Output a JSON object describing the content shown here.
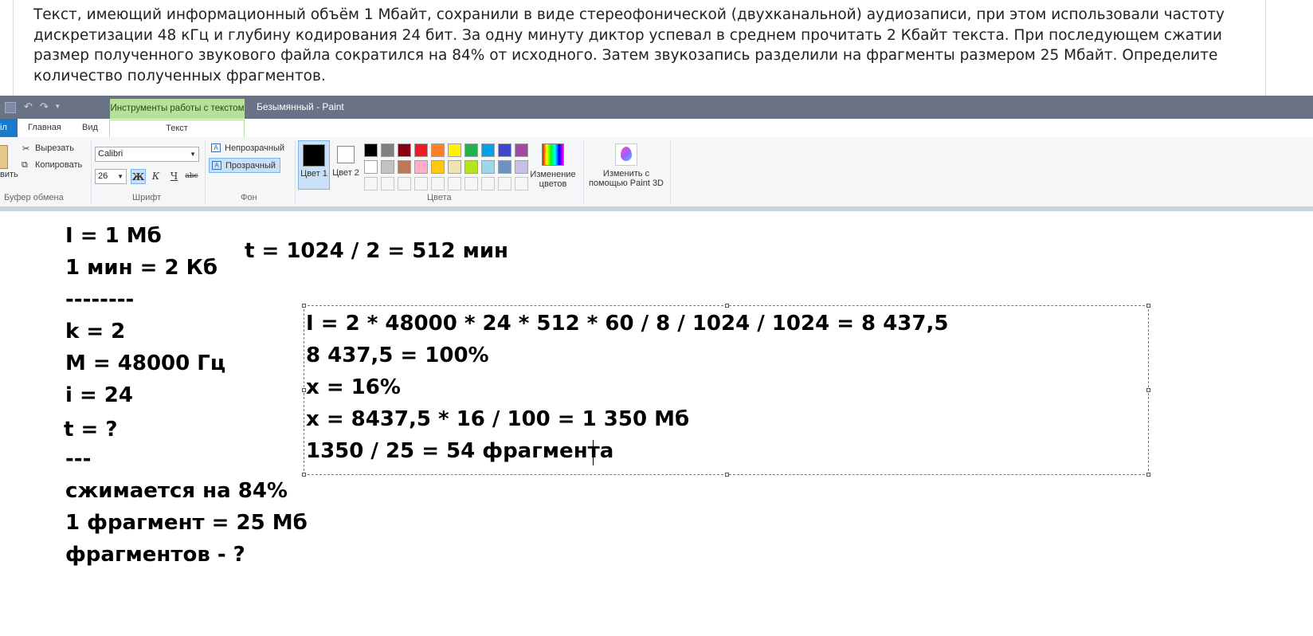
{
  "task": {
    "text": "Текст, имеющий информационный объём 1 Мбайт, сохранили в виде стереофонической (двухканальной) аудиозаписи, при этом использовали частоту дискретизации 48 кГц и глубину кодирования 24 бит. За одну минуту диктор успевал в среднем прочитать 2 Кбайт текста. При последующем сжатии размер полученного звукового файла сократился на 84% от исходного. Затем звукозапись разделили на фрагменты размером 25 Мбайт. Определите количество полученных фрагментов."
  },
  "window": {
    "tools_tab": "Инструменты работы с текстом",
    "title": "Безымянный - Paint"
  },
  "tabs": {
    "file": "іл",
    "home": "Главная",
    "view": "Вид",
    "text": "Текст"
  },
  "clipboard": {
    "paste": "вить",
    "cut": "Вырезать",
    "copy": "Копировать",
    "label": "Буфер обмена"
  },
  "font": {
    "family": "Calibri",
    "size": "26",
    "bold": "Ж",
    "italic": "К",
    "underline": "Ч",
    "strike": "abc",
    "label": "Шрифт"
  },
  "background": {
    "opaque": "Непрозрачный",
    "transparent": "Прозрачный",
    "label": "Фон"
  },
  "colors": {
    "color1": "Цвет 1",
    "color2": "Цвет 2",
    "edit": "Изменение цветов",
    "label": "Цвета",
    "color1_value": "#000000",
    "color2_value": "#ffffff",
    "palette_row1": [
      "#000000",
      "#7f7f7f",
      "#880015",
      "#ed1c24",
      "#ff7f27",
      "#fff200",
      "#22b14c",
      "#00a2e8",
      "#3f48cc",
      "#a349a4"
    ],
    "palette_row2": [
      "#ffffff",
      "#c3c3c3",
      "#b97a57",
      "#ffaec9",
      "#ffc90e",
      "#efe4b0",
      "#b5e61d",
      "#99d9ea",
      "#7092be",
      "#c8bfe7"
    ]
  },
  "paint3d": {
    "label": "Изменить с помощью Paint 3D"
  },
  "canvas": {
    "left_lines": [
      "I = 1 Мб",
      "1 мин = 2 Кб",
      "--------",
      "k = 2",
      "M = 48000 Гц",
      "i = 24",
      "t = ?",
      "---",
      "сжимается на 84%",
      "1 фрагмент = 25 Мб",
      "фрагментов - ?"
    ],
    "time_line": "t = 1024 / 2 = 512 мин",
    "box_lines": [
      "I = 2 * 48000 * 24 * 512 * 60 / 8 / 1024 / 1024 = 8 437,5",
      "8 437,5  = 100%",
      "x = 16%",
      "x = 8437,5 * 16 / 100 = 1 350 Мб",
      "1350 / 25 = 54 фрагмента"
    ]
  }
}
